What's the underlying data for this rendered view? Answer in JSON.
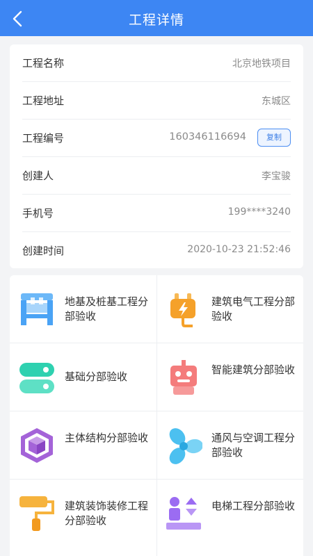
{
  "header": {
    "title": "工程详情",
    "back_icon": "arrow-left-icon"
  },
  "info": {
    "name_label": "工程名称",
    "name_value": "北京地铁项目",
    "address_label": "工程地址",
    "address_value": "东城区",
    "code_label": "工程编号",
    "code_value": "160346116694",
    "copy_label": "复制",
    "creator_label": "创建人",
    "creator_value": "李宝骏",
    "phone_label": "手机号",
    "phone_value": "199****3240",
    "time_label": "创建时间",
    "time_value": "2020-10-23 21:52:46"
  },
  "grid": {
    "items": [
      {
        "label": "地基及桩基工程分部验收",
        "icon": "foundation-icon",
        "color": "#4aa3f5"
      },
      {
        "label": "建筑电气工程分部验收",
        "icon": "electric-plug-icon",
        "color": "#f5a12a"
      },
      {
        "label": "基础分部验收",
        "icon": "database-icon",
        "color": "#2ed1b0"
      },
      {
        "label": "智能建筑分部验收",
        "icon": "robot-icon",
        "color": "#f47c7c"
      },
      {
        "label": "主体结构分部验收",
        "icon": "cube-icon",
        "color": "#a463d8"
      },
      {
        "label": "通风与空调工程分部验收",
        "icon": "fan-icon",
        "color": "#4cc0f0"
      },
      {
        "label": "建筑装饰装修工程分部验收",
        "icon": "paint-roller-icon",
        "color": "#f6b33d"
      },
      {
        "label": "电梯工程分部验收",
        "icon": "elevator-icon",
        "color": "#9b6cf2"
      }
    ]
  }
}
